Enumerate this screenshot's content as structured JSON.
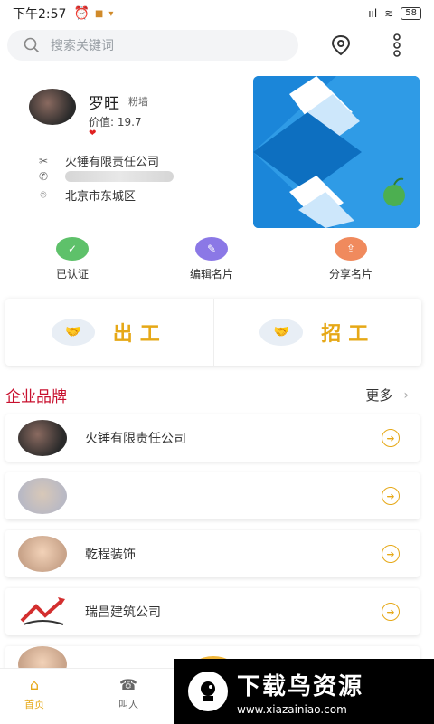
{
  "status_bar": {
    "time": "下午2:57",
    "signal": "ııl",
    "wifi_label": "≋",
    "battery": "58"
  },
  "search": {
    "placeholder": "搜索关键词"
  },
  "profile": {
    "name": "罗旺",
    "tag": "粉墙",
    "value": "价值: 19.7",
    "company": "火锤有限责任公司",
    "address": "北京市东城区"
  },
  "actions": [
    {
      "label": "已认证",
      "color": "#5ec16a"
    },
    {
      "label": "编辑名片",
      "color": "#8b78e6"
    },
    {
      "label": "分享名片",
      "color": "#f08a5d"
    }
  ],
  "work": [
    {
      "label": "出工"
    },
    {
      "label": "招工"
    }
  ],
  "section": {
    "title": "企业品牌",
    "more": "更多"
  },
  "brands": [
    {
      "name": "火锤有限责任公司"
    },
    {
      "name": ""
    },
    {
      "name": "乾程装饰"
    },
    {
      "name": "瑞昌建筑公司"
    }
  ],
  "nav": [
    {
      "label": "首页"
    },
    {
      "label": "叫人"
    }
  ],
  "watermark": {
    "title": "下载鸟资源",
    "url": "www.xiazainiao.com"
  },
  "colors": {
    "accent": "#e6a817",
    "section_title": "#c8102e",
    "banner": "#1b86d9"
  }
}
